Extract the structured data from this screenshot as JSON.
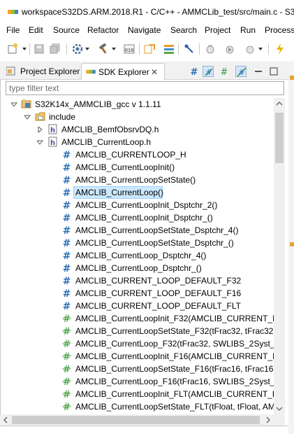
{
  "window": {
    "title": "workspaceS32DS.ARM.2018.R1 - C/C++ - AMMCLib_test/src/main.c - S32"
  },
  "menu": [
    "File",
    "Edit",
    "Source",
    "Refactor",
    "Navigate",
    "Search",
    "Project",
    "Run",
    "Processo"
  ],
  "toolbar": {
    "icons": [
      "new-icon",
      "save-icon",
      "save-all-icon",
      "settings-icon",
      "build-hammer-icon",
      "binary-icon",
      "open-element-icon",
      "stack-icon",
      "pin-icon",
      "debug-config-icon",
      "run-config-icon",
      "lightning-icon"
    ]
  },
  "tabs": [
    {
      "label": "Project Explorer",
      "icon": "project-explorer-icon",
      "active": false
    },
    {
      "label": "SDK Explorer",
      "icon": "nxp-icon",
      "active": true,
      "close": "✕"
    }
  ],
  "view_actions": [
    "show-definitions-icon",
    "link-icon",
    "collapse-icon",
    "filter-icon",
    "minimize-icon",
    "maximize-icon"
  ],
  "filter": {
    "placeholder": "type filter text",
    "value": ""
  },
  "tree": [
    {
      "label": "S32K14x_AMMCLIB_gcc v 1.1.11",
      "level": 0,
      "twisty": "expanded",
      "icon": "sdk-icon"
    },
    {
      "label": "include",
      "level": 1,
      "twisty": "expanded",
      "icon": "folder-icon"
    },
    {
      "label": "AMCLIB_BemfObsrvDQ.h",
      "level": 2,
      "twisty": "collapsed",
      "icon": "header-file-icon"
    },
    {
      "label": "AMCLIB_CurrentLoop.h",
      "level": 2,
      "twisty": "expanded",
      "icon": "header-file-icon"
    },
    {
      "label": "AMCLIB_CURRENTLOOP_H",
      "level": 3,
      "icon": "macro-icon"
    },
    {
      "label": "AMCLIB_CurrentLoopInit()",
      "level": 3,
      "icon": "macro-icon"
    },
    {
      "label": "AMCLIB_CurrentLoopSetState()",
      "level": 3,
      "icon": "macro-icon"
    },
    {
      "label": "AMCLIB_CurrentLoop()",
      "level": 3,
      "icon": "macro-icon",
      "selected": true
    },
    {
      "label": "AMCLIB_CurrentLoopInit_Dsptchr_2()",
      "level": 3,
      "icon": "macro-icon"
    },
    {
      "label": "AMCLIB_CurrentLoopInit_Dsptchr_()",
      "level": 3,
      "icon": "macro-icon"
    },
    {
      "label": "AMCLIB_CurrentLoopSetState_Dsptchr_4()",
      "level": 3,
      "icon": "macro-icon"
    },
    {
      "label": "AMCLIB_CurrentLoopSetState_Dsptchr_()",
      "level": 3,
      "icon": "macro-icon"
    },
    {
      "label": "AMCLIB_CurrentLoop_Dsptchr_4()",
      "level": 3,
      "icon": "macro-icon"
    },
    {
      "label": "AMCLIB_CurrentLoop_Dsptchr_()",
      "level": 3,
      "icon": "macro-icon"
    },
    {
      "label": "AMCLIB_CURRENT_LOOP_DEFAULT_F32",
      "level": 3,
      "icon": "macro-icon"
    },
    {
      "label": "AMCLIB_CURRENT_LOOP_DEFAULT_F16",
      "level": 3,
      "icon": "macro-icon"
    },
    {
      "label": "AMCLIB_CURRENT_LOOP_DEFAULT_FLT",
      "level": 3,
      "icon": "macro-icon"
    },
    {
      "label": "AMCLIB_CurrentLoopInit_F32(AMCLIB_CURRENT_LOO",
      "level": 3,
      "icon": "function-icon"
    },
    {
      "label": "AMCLIB_CurrentLoopSetState_F32(tFrac32, tFrac32, AM",
      "level": 3,
      "icon": "function-icon"
    },
    {
      "label": "AMCLIB_CurrentLoop_F32(tFrac32, SWLIBS_2Syst_F32*",
      "level": 3,
      "icon": "function-icon"
    },
    {
      "label": "AMCLIB_CurrentLoopInit_F16(AMCLIB_CURRENT_LOO",
      "level": 3,
      "icon": "function-icon"
    },
    {
      "label": "AMCLIB_CurrentLoopSetState_F16(tFrac16, tFrac16, AM",
      "level": 3,
      "icon": "function-icon"
    },
    {
      "label": "AMCLIB_CurrentLoop_F16(tFrac16, SWLIBS_2Syst_F16*",
      "level": 3,
      "icon": "function-icon"
    },
    {
      "label": "AMCLIB_CurrentLoopInit_FLT(AMCLIB_CURRENT_LOO",
      "level": 3,
      "icon": "function-icon"
    },
    {
      "label": "AMCLIB_CurrentLoopSetState_FLT(tFloat, tFloat, AMC",
      "level": 3,
      "icon": "function-icon"
    }
  ],
  "colors": {
    "nxp_orange": "#f5a623",
    "nxp_blue": "#7ab51d",
    "macro_blue": "#2c6fb7",
    "function_green": "#3a9a3a",
    "selection": "#cce8ff"
  }
}
